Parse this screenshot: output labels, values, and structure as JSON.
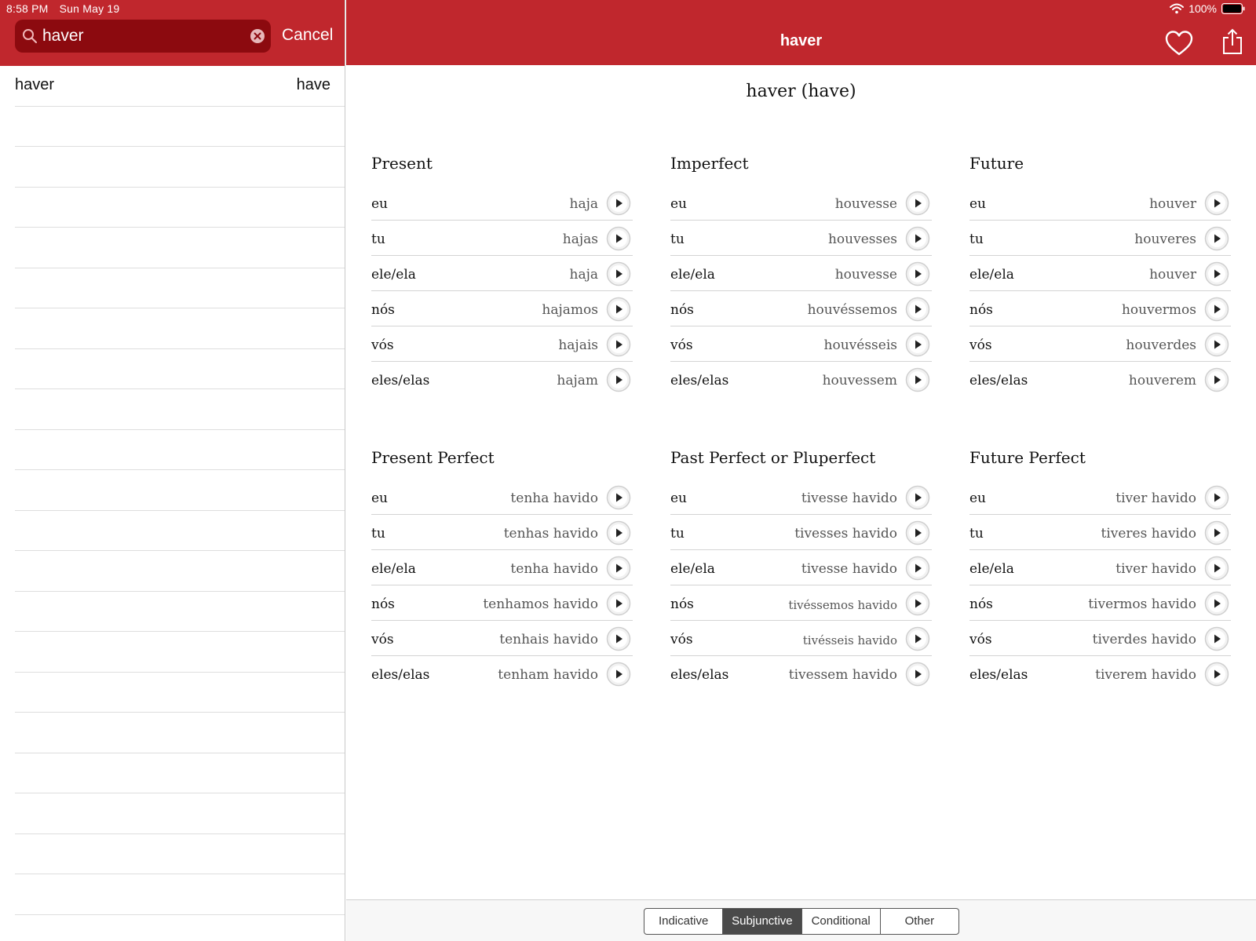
{
  "status_bar": {
    "time": "8:58 PM",
    "date": "Sun May 19",
    "battery": "100%"
  },
  "search": {
    "value": "haver",
    "cancel_label": "Cancel"
  },
  "results": [
    {
      "word": "haver",
      "translation": "have"
    }
  ],
  "nav": {
    "title": "haver"
  },
  "verb_heading": "haver (have)",
  "tenses": [
    {
      "title": "Present",
      "rows": [
        {
          "pronoun": "eu",
          "form": "haja"
        },
        {
          "pronoun": "tu",
          "form": "hajas"
        },
        {
          "pronoun": "ele/ela",
          "form": "haja"
        },
        {
          "pronoun": "nós",
          "form": "hajamos"
        },
        {
          "pronoun": "vós",
          "form": "hajais"
        },
        {
          "pronoun": "eles/elas",
          "form": "hajam"
        }
      ]
    },
    {
      "title": "Imperfect",
      "rows": [
        {
          "pronoun": "eu",
          "form": "houvesse"
        },
        {
          "pronoun": "tu",
          "form": "houvesses"
        },
        {
          "pronoun": "ele/ela",
          "form": "houvesse"
        },
        {
          "pronoun": "nós",
          "form": "houvéssemos"
        },
        {
          "pronoun": "vós",
          "form": "houvésseis"
        },
        {
          "pronoun": "eles/elas",
          "form": "houvessem"
        }
      ]
    },
    {
      "title": "Future",
      "rows": [
        {
          "pronoun": "eu",
          "form": "houver"
        },
        {
          "pronoun": "tu",
          "form": "houveres"
        },
        {
          "pronoun": "ele/ela",
          "form": "houver"
        },
        {
          "pronoun": "nós",
          "form": "houvermos"
        },
        {
          "pronoun": "vós",
          "form": "houverdes"
        },
        {
          "pronoun": "eles/elas",
          "form": "houverem"
        }
      ]
    },
    {
      "title": "Present Perfect",
      "rows": [
        {
          "pronoun": "eu",
          "form": "tenha havido"
        },
        {
          "pronoun": "tu",
          "form": "tenhas havido"
        },
        {
          "pronoun": "ele/ela",
          "form": "tenha havido"
        },
        {
          "pronoun": "nós",
          "form": "tenhamos havido"
        },
        {
          "pronoun": "vós",
          "form": "tenhais havido"
        },
        {
          "pronoun": "eles/elas",
          "form": "tenham havido"
        }
      ]
    },
    {
      "title": "Past Perfect or Pluperfect",
      "rows": [
        {
          "pronoun": "eu",
          "form": "tivesse havido"
        },
        {
          "pronoun": "tu",
          "form": "tivesses havido"
        },
        {
          "pronoun": "ele/ela",
          "form": "tivesse havido"
        },
        {
          "pronoun": "nós",
          "form": "tivéssemos havido"
        },
        {
          "pronoun": "vós",
          "form": "tivésseis havido"
        },
        {
          "pronoun": "eles/elas",
          "form": "tivessem havido"
        }
      ]
    },
    {
      "title": "Future Perfect",
      "rows": [
        {
          "pronoun": "eu",
          "form": "tiver havido"
        },
        {
          "pronoun": "tu",
          "form": "tiveres havido"
        },
        {
          "pronoun": "ele/ela",
          "form": "tiver havido"
        },
        {
          "pronoun": "nós",
          "form": "tivermos havido"
        },
        {
          "pronoun": "vós",
          "form": "tiverdes havido"
        },
        {
          "pronoun": "eles/elas",
          "form": "tiverem havido"
        }
      ]
    }
  ],
  "mood_tabs": [
    "Indicative",
    "Subjunctive",
    "Conditional",
    "Other"
  ],
  "active_mood": "Subjunctive",
  "icons": {
    "search": "search-icon",
    "clear": "clear-icon",
    "favorite": "heart-icon",
    "share": "share-icon",
    "play": "play-icon",
    "wifi": "wifi-icon",
    "battery": "battery-icon"
  },
  "colors": {
    "brand_red": "#c0272d",
    "search_field": "#8c0a0f",
    "active_segment": "#4a4a4a"
  }
}
